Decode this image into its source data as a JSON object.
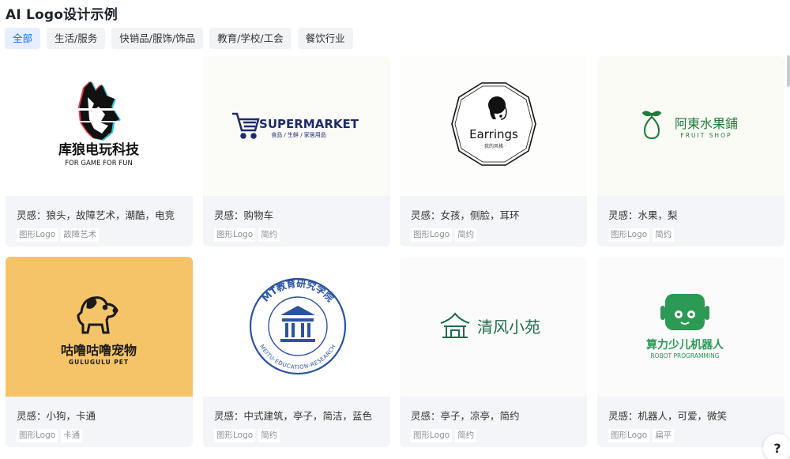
{
  "page": {
    "title": "AI Logo设计示例"
  },
  "tabs": [
    {
      "label": "全部",
      "active": true
    },
    {
      "label": "生活/服务",
      "active": false
    },
    {
      "label": "快销品/服饰/饰品",
      "active": false
    },
    {
      "label": "教育/学校/工会",
      "active": false
    },
    {
      "label": "餐饮行业",
      "active": false
    }
  ],
  "cards": [
    {
      "inspiration": "灵感：狼头，故障艺术，潮酷，电竞",
      "tags": [
        "图形Logo",
        "故障艺术"
      ],
      "logo": {
        "name": "库狼电玩科技",
        "tagline": "FOR GAME FOR FUN",
        "icon": "wolf-head-icon",
        "bg": "#ffffff"
      }
    },
    {
      "inspiration": "灵感：购物车",
      "tags": [
        "图形Logo",
        "简约"
      ],
      "logo": {
        "name": "SUPERMARKET",
        "tagline": "食品 / 生鲜 / 家居用品",
        "icon": "shopping-cart-icon",
        "bg": "#fbfbf7",
        "color": "#1f2a6d"
      }
    },
    {
      "inspiration": "灵感：女孩，侧脸，耳环",
      "tags": [
        "图形Logo",
        "简约"
      ],
      "logo": {
        "name": "Earrings",
        "tagline": "· 我的风格 ·",
        "icon": "woman-profile-icon",
        "bg": "#fdfdfc"
      }
    },
    {
      "inspiration": "灵感：水果，梨",
      "tags": [
        "图形Logo",
        "简约"
      ],
      "logo": {
        "name": "阿東水果鋪",
        "tagline": "FRUIT SHOP",
        "icon": "pear-icon",
        "bg": "#fbfbf6",
        "color": "#1e7a3a"
      }
    },
    {
      "inspiration": "灵感：小狗，卡通",
      "tags": [
        "图形Logo",
        "卡通"
      ],
      "logo": {
        "name": "咕噜咕噜宠物",
        "tagline": "GULUGULU PET",
        "icon": "dog-icon",
        "bg": "#f5c468"
      }
    },
    {
      "inspiration": "灵感：中式建筑，亭子，简洁，蓝色",
      "tags": [
        "图形Logo",
        "简约"
      ],
      "logo": {
        "name": "MT教育研究学院",
        "tagline": "MEITU-EDUCATION-RESEARCH",
        "icon": "pavilion-seal-icon",
        "bg": "#ffffff",
        "color": "#2a53a4"
      }
    },
    {
      "inspiration": "灵感：亭子，凉亭，简约",
      "tags": [
        "图形Logo",
        "简约"
      ],
      "logo": {
        "name": "清风小苑",
        "tagline": "",
        "icon": "pavilion-icon",
        "bg": "#fbfbfb",
        "color": "#1f6b4a"
      }
    },
    {
      "inspiration": "灵感：机器人，可爱，微笑",
      "tags": [
        "图形Logo",
        "扁平"
      ],
      "logo": {
        "name": "算力少儿机器人",
        "tagline": "ROBOT PROGRAMMING",
        "icon": "robot-icon",
        "bg": "#fbfbfb",
        "color": "#2b9a55"
      }
    }
  ],
  "help": {
    "label": "?"
  }
}
